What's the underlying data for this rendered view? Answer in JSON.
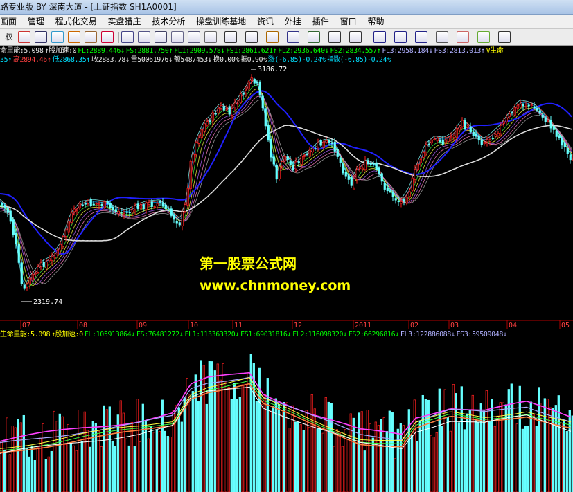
{
  "window": {
    "title": "路专业版 BY 深南大道 - [上证指数 SH1A0001]"
  },
  "menu": [
    "画面",
    "管理",
    "程式化交易",
    "实盘猎庄",
    "技术分析",
    "操盘训练基地",
    "资讯",
    "外挂",
    "插件",
    "窗口",
    "帮助"
  ],
  "toolbar": {
    "left_label": "权",
    "icons": [
      "chart-icon",
      "compare-icon",
      "trade-icon",
      "flag-icon",
      "color-icon",
      "alert-icon",
      "layout-icon",
      "grid-icon",
      "table-icon",
      "window-icon",
      "split-icon",
      "monitor-icon",
      "pointer-icon",
      "line-draw-icon",
      "fib-icon",
      "grid-lines-icon",
      "fan-icon",
      "channel-icon",
      "parallel-icon",
      "rect-icon",
      "ellipse-icon",
      "text-icon",
      "copy-icon",
      "eraser-icon",
      "palette-icon",
      "save-icon"
    ]
  },
  "price_panel": {
    "indicator_line": [
      {
        "text": "命里能:5.098",
        "color": "#e8e8e8"
      },
      {
        "text": "↑股加速:0",
        "color": "#e8e8e8"
      },
      {
        "text": "FL:2889.446↓",
        "color": "#00ff00"
      },
      {
        "text": "FS:2881.750↑",
        "color": "#00ff00"
      },
      {
        "text": "FL1:2909.578↓",
        "color": "#00ff00"
      },
      {
        "text": "FS1:2861.621↑",
        "color": "#00ff00"
      },
      {
        "text": "FL2:2936.640↓",
        "color": "#00ff00"
      },
      {
        "text": "FS2:2834.557↑",
        "color": "#00ff00"
      },
      {
        "text": "FL3:2958.184↓",
        "color": "#b0b0ff"
      },
      {
        "text": "FS3:2813.013↑",
        "color": "#b0b0ff"
      },
      {
        "text": "V生命",
        "color": "#ffff00"
      }
    ],
    "quote_line": [
      {
        "text": "35↑",
        "color": "#00e0ff"
      },
      {
        "text": "高2894.46↑",
        "color": "#ff4040"
      },
      {
        "text": "低2868.35↑",
        "color": "#00e0ff"
      },
      {
        "text": "收2883.78↓",
        "color": "#e8e8e8"
      },
      {
        "text": "量50061976↓",
        "color": "#e8e8e8"
      },
      {
        "text": "额5487453↓",
        "color": "#e8e8e8"
      },
      {
        "text": "换0.00%",
        "color": "#e8e8e8"
      },
      {
        "text": "振0.90%",
        "color": "#e8e8e8"
      },
      {
        "text": "涨(-6.85)-0.24%",
        "color": "#00e0ff"
      },
      {
        "text": "指数(-6.85)-0.24%",
        "color": "#00e0ff"
      }
    ],
    "high_label": "3186.72",
    "low_label": "2319.74"
  },
  "time_axis": [
    "07",
    "08",
    "09",
    "10",
    "11",
    "12",
    "2011",
    "02",
    "03",
    "04",
    "05"
  ],
  "volume_panel": {
    "indicator_line": [
      {
        "text": "生命里能:5.098",
        "color": "#ffff00"
      },
      {
        "text": "↑股加速:0",
        "color": "#ffff00"
      },
      {
        "text": "FL:105913864↓",
        "color": "#00ff00"
      },
      {
        "text": "FS:76481272↓",
        "color": "#00ff00"
      },
      {
        "text": "FL1:113363320↓",
        "color": "#00ff00"
      },
      {
        "text": "FS1:69031816↓",
        "color": "#00ff00"
      },
      {
        "text": "FL2:116098320↓",
        "color": "#00ff00"
      },
      {
        "text": "FS2:66296816↓",
        "color": "#00ff00"
      },
      {
        "text": "FL3:122886088↓",
        "color": "#b0b0ff"
      },
      {
        "text": "FS3:59509048↓",
        "color": "#b0b0ff"
      }
    ]
  },
  "watermark": {
    "line1": "第一股票公式网",
    "line2": "www.chnmoney.com"
  },
  "colors": {
    "up": "#ff2020",
    "down": "#66ffff",
    "ma_white": "#dcdcdc",
    "ma_blue": "#2020ff",
    "ma_magenta": "#ff40ff",
    "grid_red": "#b00000"
  }
}
